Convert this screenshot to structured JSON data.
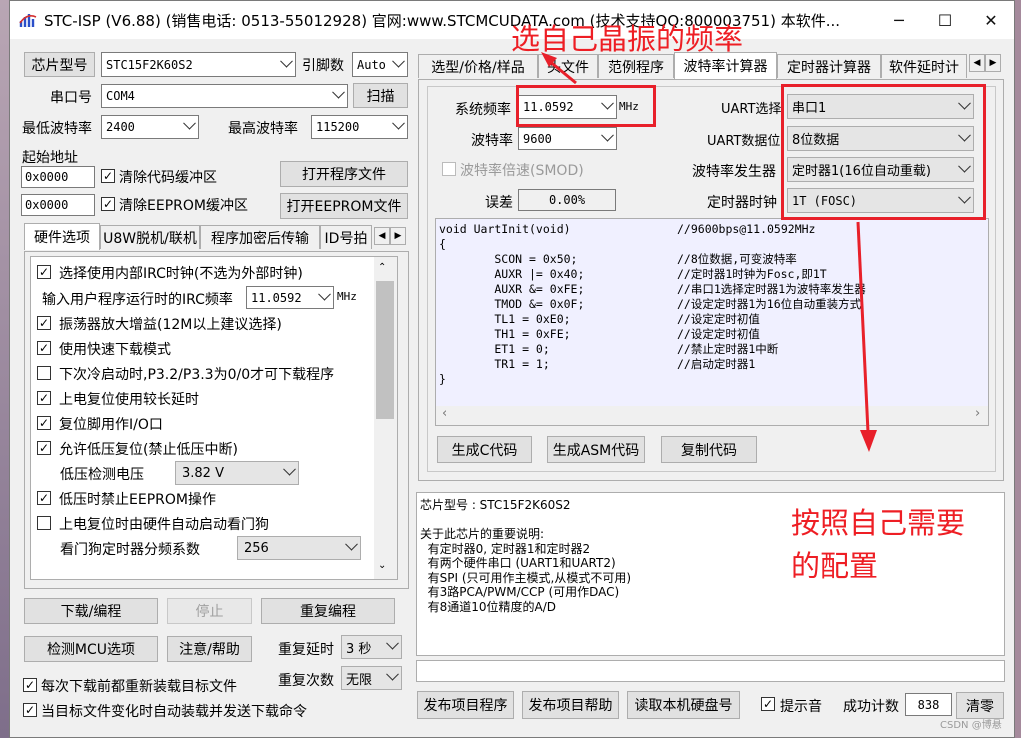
{
  "window": {
    "title": "STC-ISP (V6.88) (销售电话: 0513-55012928) 官网:www.STCMCUDATA.com  (技术支持QQ:800003751) 本软件...",
    "minimize": "─",
    "maximize": "☐",
    "close": "✕"
  },
  "left": {
    "chip_model_button": "芯片型号",
    "chip_model_value": "STC15F2K60S2",
    "pin_count_label": "引脚数",
    "pin_count_value": "Auto",
    "serial_port_label": "串口号",
    "serial_port_value": "COM4",
    "scan_button": "扫描",
    "min_baud_label": "最低波特率",
    "min_baud_value": "2400",
    "max_baud_label": "最高波特率",
    "max_baud_value": "115200",
    "start_addr_label": "起始地址",
    "code_addr": "0x0000",
    "clear_code_label": "清除代码缓冲区",
    "open_program_button": "打开程序文件",
    "eeprom_addr": "0x0000",
    "clear_eeprom_label": "清除EEPROM缓冲区",
    "open_eeprom_button": "打开EEPROM文件",
    "tabs": [
      "硬件选项",
      "U8W脱机/联机",
      "程序加密后传输",
      "ID号拍"
    ],
    "options": {
      "irc_clock": "选择使用内部IRC时钟(不选为外部时钟)",
      "irc_freq_label": "输入用户程序运行时的IRC频率",
      "irc_freq_value": "11.0592",
      "irc_freq_unit": "MHz",
      "osc_gain": "振荡器放大增益(12M以上建议选择)",
      "fast_download": "使用快速下载模式",
      "cold_start": "下次冷启动时,P3.2/P3.3为0/0才可下载程序",
      "power_delay": "上电复位使用较长延时",
      "reset_io": "复位脚用作I/O口",
      "lvd_reset": "允许低压复位(禁止低压中断)",
      "lvd_voltage_label": "低压检测电压",
      "lvd_voltage_value": "3.82 V",
      "lvd_eeprom": "低压时禁止EEPROM操作",
      "watchdog": "上电复位时由硬件自动启动看门狗",
      "wdt_prescale_label": "看门狗定时器分频系数",
      "wdt_prescale_value": "256"
    },
    "download_button": "下载/编程",
    "stop_button": "停止",
    "reprogram_button": "重复编程",
    "check_mcu_button": "检测MCU选项",
    "help_button": "注意/帮助",
    "repeat_delay_label": "重复延时",
    "repeat_delay_value": "3 秒",
    "repeat_count_label": "重复次数",
    "repeat_count_value": "无限",
    "reload_before_download": "每次下载前都重新装载目标文件",
    "auto_load_on_change": "当目标文件变化时自动装载并发送下载命令"
  },
  "right": {
    "tabs": [
      "选型/价格/样品",
      "头文件",
      "范例程序",
      "波特率计算器",
      "定时器计算器",
      "软件延时计"
    ],
    "sys_freq_label": "系统频率",
    "sys_freq_value": "11.0592",
    "sys_freq_unit": "MHz",
    "baud_label": "波特率",
    "baud_value": "9600",
    "smod_label": "波特率倍速(SMOD)",
    "error_label": "误差",
    "error_value": "0.00%",
    "uart_label": "UART选择",
    "uart_value": "串口1",
    "uart_bits_label": "UART数据位",
    "uart_bits_value": "8位数据",
    "baud_gen_label": "波特率发生器",
    "baud_gen_value": "定时器1(16位自动重载)",
    "timer_clock_label": "定时器时钟",
    "timer_clock_value": "1T  (FOSC)",
    "code_lines": [
      {
        "c": "void UartInit(void)",
        "m": "//9600bps@11.0592MHz"
      },
      {
        "c": "{",
        "m": ""
      },
      {
        "c": "        SCON = 0x50;",
        "m": "//8位数据,可变波特率"
      },
      {
        "c": "        AUXR |= 0x40;",
        "m": "//定时器1时钟为Fosc,即1T"
      },
      {
        "c": "        AUXR &= 0xFE;",
        "m": "//串口1选择定时器1为波特率发生器"
      },
      {
        "c": "        TMOD &= 0x0F;",
        "m": "//设定定时器1为16位自动重装方式"
      },
      {
        "c": "        TL1 = 0xE0;",
        "m": "//设定定时初值"
      },
      {
        "c": "        TH1 = 0xFE;",
        "m": "//设定定时初值"
      },
      {
        "c": "        ET1 = 0;",
        "m": "//禁止定时器1中断"
      },
      {
        "c": "        TR1 = 1;",
        "m": "//启动定时器1"
      },
      {
        "c": "}",
        "m": ""
      }
    ],
    "gen_c_button": "生成C代码",
    "gen_asm_button": "生成ASM代码",
    "copy_button": "复制代码",
    "info_lines": [
      "芯片型号 : STC15F2K60S2",
      "",
      "关于此芯片的重要说明:",
      "  有定时器0, 定时器1和定时器2",
      "  有两个硬件串口 (UART1和UART2)",
      "  有SPI (只可用作主模式,从模式不可用)",
      "  有3路PCA/PWM/CCP (可用作DAC)",
      "  有8通道10位精度的A/D"
    ],
    "publish_button": "发布项目程序",
    "publish_help_button": "发布项目帮助",
    "read_disk_button": "读取本机硬盘号",
    "beep_label": "提示音",
    "success_label": "成功计数",
    "success_value": "838",
    "clear_button": "清零"
  },
  "annotations": {
    "top": "选自己晶振的频率",
    "bottom_line1": "按照自己需要",
    "bottom_line2": "的配置",
    "color": "#ee1e24"
  },
  "watermark": "CSDN @博悬"
}
